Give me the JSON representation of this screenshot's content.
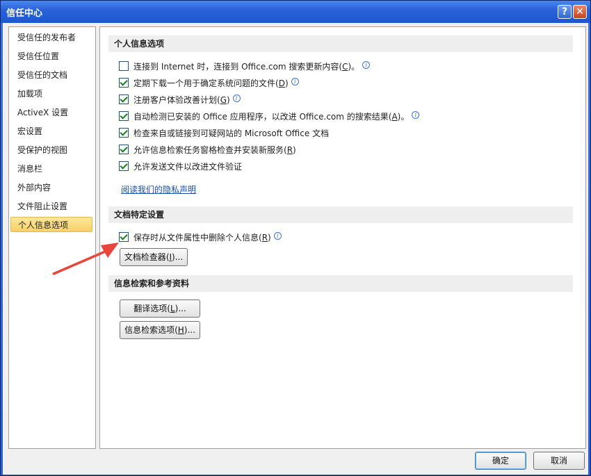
{
  "window": {
    "title": "信任中心"
  },
  "titlebar": {
    "help_glyph": "?",
    "close_glyph": "✕"
  },
  "nav": {
    "items": [
      {
        "label": "受信任的发布者"
      },
      {
        "label": "受信任位置"
      },
      {
        "label": "受信任的文档"
      },
      {
        "label": "加载项"
      },
      {
        "label": "ActiveX 设置"
      },
      {
        "label": "宏设置"
      },
      {
        "label": "受保护的视图"
      },
      {
        "label": "消息栏"
      },
      {
        "label": "外部内容"
      },
      {
        "label": "文件阻止设置"
      },
      {
        "label": "个人信息选项",
        "selected": true
      }
    ]
  },
  "sections": {
    "personal": {
      "header": "个人信息选项",
      "options": [
        {
          "label": "连接到 Internet 时，连接到 Office.com 搜索更新内容",
          "key": "C",
          "suffix": "。",
          "checked": false,
          "info": true
        },
        {
          "label": "定期下载一个用于确定系统问题的文件",
          "key": "D",
          "suffix": "",
          "checked": true,
          "info": true
        },
        {
          "label": "注册客户体验改善计划",
          "key": "G",
          "suffix": "",
          "checked": true,
          "info": true
        },
        {
          "label": "自动检测已安装的 Office 应用程序，以改进 Office.com 的搜索结果",
          "key": "A",
          "suffix": "。",
          "checked": true,
          "info": true
        },
        {
          "label": "检查来自或链接到可疑网站的 Microsoft Office 文档",
          "key": "",
          "suffix": "",
          "checked": true,
          "info": false
        },
        {
          "label": "允许信息检索任务窗格检查并安装新服务",
          "key": "R",
          "suffix": "",
          "checked": true,
          "info": false
        },
        {
          "label": "允许发送文件以改进文件验证",
          "key": "",
          "suffix": "",
          "checked": true,
          "info": false
        }
      ],
      "privacy_link": "阅读我们的隐私声明"
    },
    "document": {
      "header": "文档特定设置",
      "option": {
        "label": "保存时从文件属性中删除个人信息",
        "key": "R",
        "checked": true,
        "info": true
      },
      "inspector_button": {
        "label": "文档检查器",
        "key": "I",
        "suffix": "..."
      }
    },
    "research": {
      "header": "信息检索和参考资料",
      "translate_button": {
        "label": "翻译选项",
        "key": "L",
        "suffix": "..."
      },
      "research_button": {
        "label": "信息检索选项",
        "key": "H",
        "suffix": "..."
      }
    }
  },
  "footer": {
    "ok_label": "确定",
    "cancel_label": "取消"
  },
  "colors": {
    "title_bar": "#2a63d8",
    "selected_nav": "#f7d366",
    "annotation_arrow": "#e8453c"
  },
  "info_glyph": "i"
}
